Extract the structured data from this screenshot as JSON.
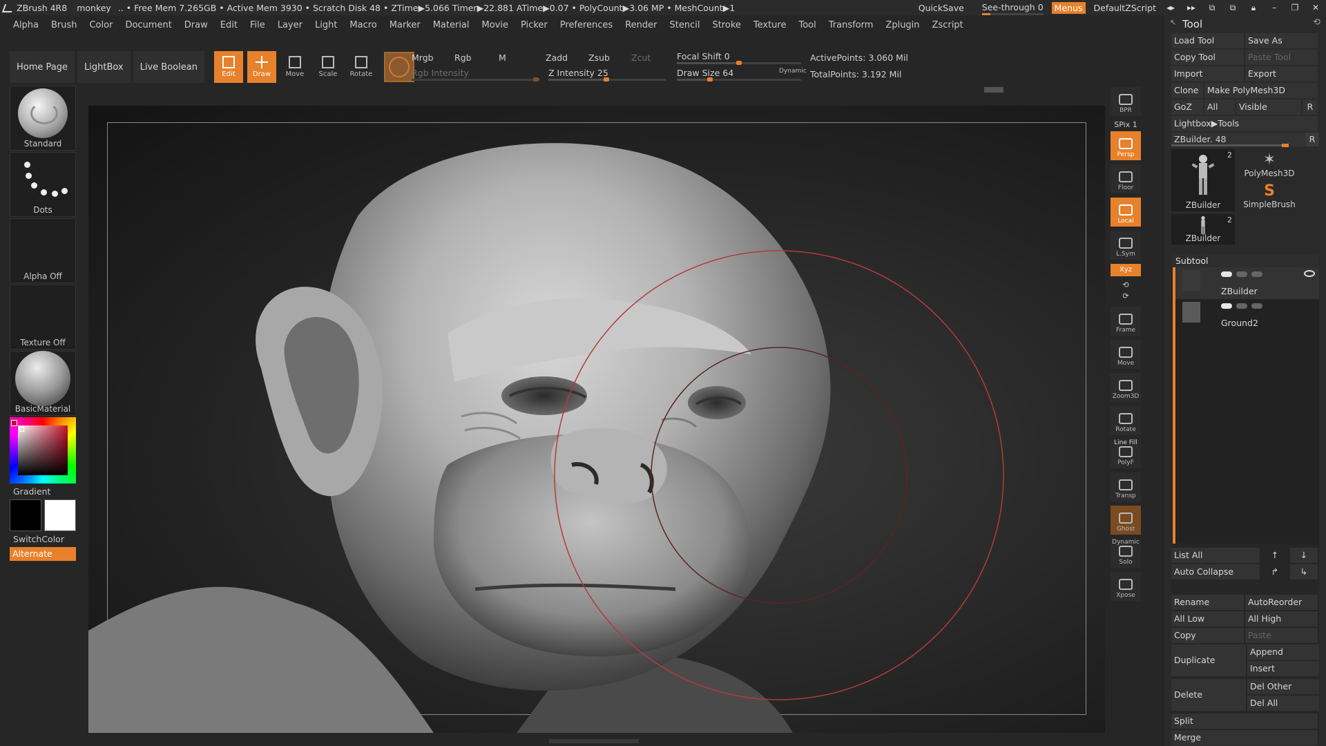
{
  "titlebar": {
    "app": "ZBrush 4R8",
    "doc": "monkey",
    "stats": ".. • Free Mem 7.265GB • Active Mem 3930 • Scratch Disk 48 • ZTime▶5.066 Timer▶22.881 ATime▶0.07 • PolyCount▶3.06 MP • MeshCount▶1",
    "quicksave": "QuickSave",
    "seethrough": "See-through  0",
    "menus": "Menus",
    "script": "DefaultZScript"
  },
  "menubar": [
    "Alpha",
    "Brush",
    "Color",
    "Document",
    "Draw",
    "Edit",
    "File",
    "Layer",
    "Light",
    "Macro",
    "Marker",
    "Material",
    "Movie",
    "Picker",
    "Preferences",
    "Render",
    "Stencil",
    "Stroke",
    "Texture",
    "Tool",
    "Transform",
    "Zplugin",
    "Zscript"
  ],
  "shelf": {
    "home": "Home Page",
    "lightbox": "LightBox",
    "liveboolean": "Live Boolean",
    "edit": "Edit",
    "draw": "Draw",
    "move": "Move",
    "scale": "Scale",
    "rotate": "Rotate",
    "mrgb": "Mrgb",
    "rgb": "Rgb",
    "m": "M",
    "rgb_intensity": "Rgb Intensity",
    "zadd": "Zadd",
    "zsub": "Zsub",
    "zcut": "Zcut",
    "z_intensity": "Z Intensity 25",
    "focal_shift": "Focal Shift 0",
    "draw_size": "Draw Size 64",
    "dynamic": "Dynamic",
    "active_points": "ActivePoints: 3.060 Mil",
    "total_points": "TotalPoints: 3.192 Mil"
  },
  "left": {
    "brush": "Standard",
    "stroke": "Dots",
    "alpha": "Alpha Off",
    "texture": "Texture Off",
    "material": "BasicMaterial",
    "gradient": "Gradient",
    "switchcolor": "SwitchColor",
    "alternate": "Alternate"
  },
  "rstrip": {
    "bpr": "BPR",
    "spix": "SPix 1",
    "persp": "Persp",
    "floor": "Floor",
    "local": "Local",
    "lsym": "L.Sym",
    "xyz": "Xyz",
    "frame": "Frame",
    "move": "Move",
    "zoom3d": "Zoom3D",
    "rotate": "Rotate",
    "linefill": "Line Fill",
    "polyf": "PolyF",
    "transp": "Transp",
    "ghost": "Ghost",
    "dynamic": "Dynamic",
    "solo": "Solo",
    "xpose": "Xpose"
  },
  "tool": {
    "title": "Tool",
    "load": "Load Tool",
    "saveas": "Save As",
    "copy": "Copy Tool",
    "paste": "Paste Tool",
    "import": "Import",
    "export": "Export",
    "clone": "Clone",
    "makepoly": "Make PolyMesh3D",
    "goz": "GoZ",
    "all": "All",
    "visible": "Visible",
    "r": "R",
    "lightbox_tools": "Lightbox▶Tools",
    "zbuilder_slider": "ZBuilder. 48",
    "item1": "ZBuilder",
    "item1_num": "2",
    "item2": "PolyMesh3D",
    "item3": "SimpleBrush",
    "item4": "ZBuilder",
    "item4_num": "2"
  },
  "subtool": {
    "title": "Subtool",
    "items": [
      "ZBuilder",
      "Ground2"
    ],
    "listall": "List All",
    "autocollapse": "Auto Collapse",
    "rename": "Rename",
    "autoreorder": "AutoReorder",
    "alllow": "All Low",
    "allhigh": "All High",
    "copy": "Copy",
    "paste": "Paste",
    "duplicate": "Duplicate",
    "append": "Append",
    "insert": "Insert",
    "delete": "Delete",
    "delother": "Del Other",
    "delall": "Del All",
    "split": "Split",
    "merge": "Merge"
  },
  "colors": {
    "accent": "#e8812b",
    "panel": "#2a2a2a",
    "background": "#262626"
  }
}
